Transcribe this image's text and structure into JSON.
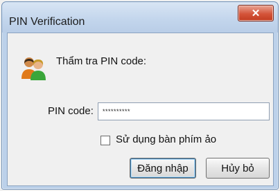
{
  "window": {
    "title": "PIN Verification",
    "close_glyph": "✕"
  },
  "dialog": {
    "heading": "Thẩm tra PIN code:",
    "icon": "users-icon",
    "pin_label": "PIN code:",
    "pin_value": "**********",
    "checkbox_label": "Sử dụng bàn phím ảo",
    "checkbox_checked": false,
    "login_button": "Đăng nhập",
    "cancel_button": "Hủy bỏ"
  },
  "colors": {
    "title_bar": "#c2d5ec",
    "close_button": "#d4543a",
    "client_bg": "#f0f0f0"
  }
}
